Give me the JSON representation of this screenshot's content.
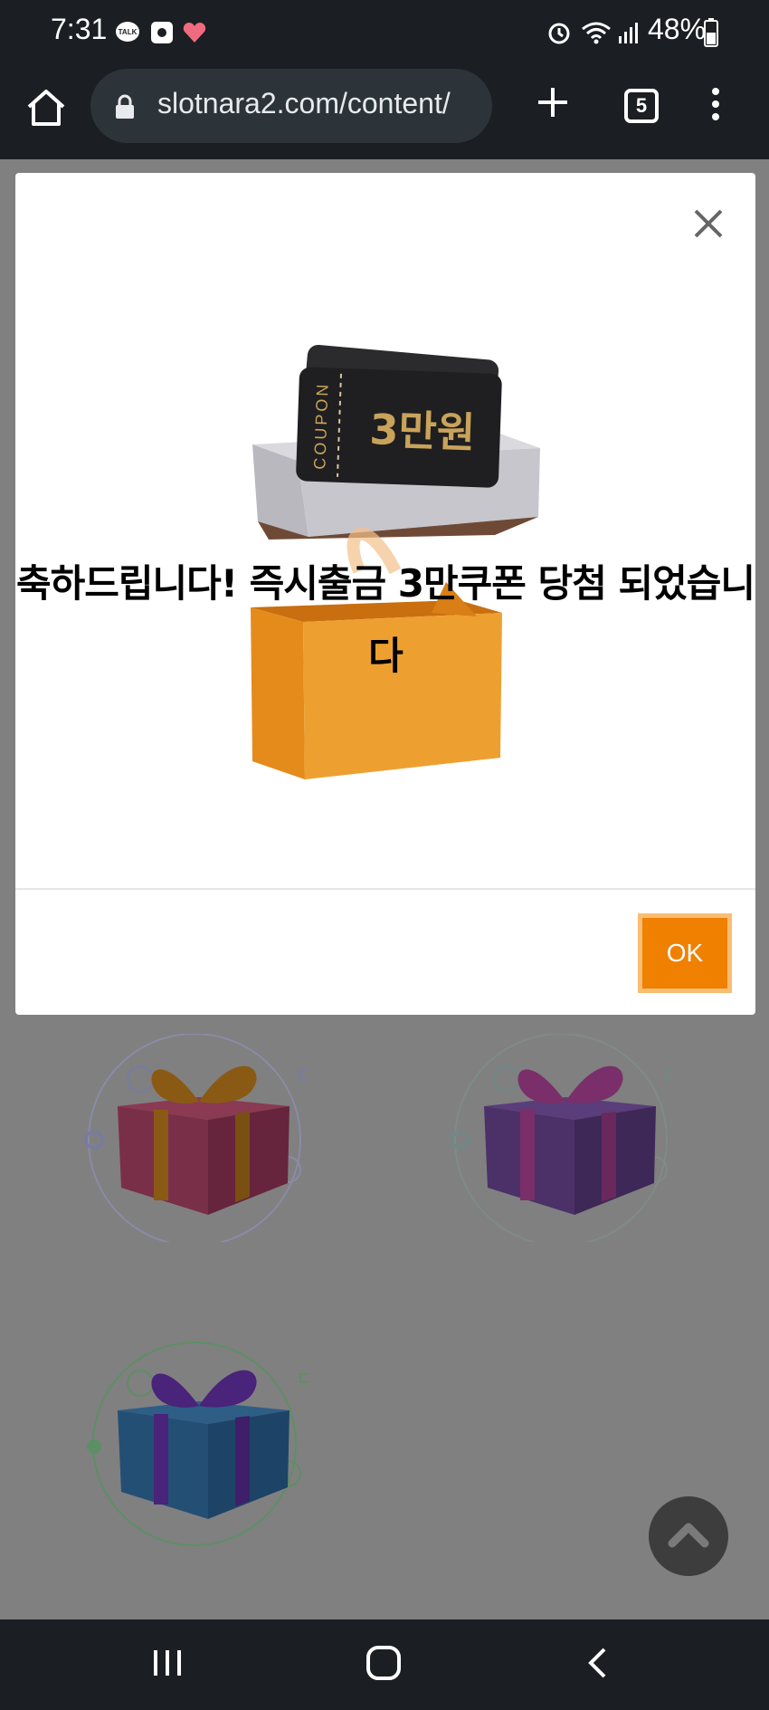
{
  "status_bar": {
    "time": "7:31",
    "battery": "48%",
    "notification_icons": [
      "kakaotalk-icon",
      "square-app-icon",
      "heart-icon"
    ],
    "system_icons": [
      "alarm-icon",
      "wifi-icon",
      "signal-icon",
      "battery-icon"
    ]
  },
  "browser": {
    "url": "slotnara2.com/content/",
    "tab_count": "5"
  },
  "modal": {
    "message": "축하드립니다! 즉시출금 3만쿠폰 당첨 되었습니다",
    "coupon_label": "COUPON",
    "coupon_amount": "3만원",
    "ok_label": "OK"
  },
  "gifts": [
    {
      "color": "crimson",
      "ribbon": "orange"
    },
    {
      "color": "purple",
      "ribbon": "magenta"
    },
    {
      "color": "blue",
      "ribbon": "violet"
    }
  ],
  "colors": {
    "accent": "#f08000",
    "accent_border": "#f9bd73",
    "overlay": "#7f7f7f",
    "chrome": "#1b1e22"
  }
}
